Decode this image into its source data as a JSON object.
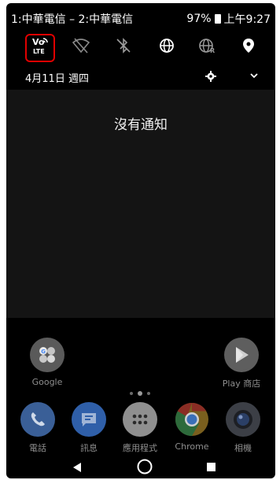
{
  "status_bar": {
    "carriers": "1:中華電信 – 2:中華電信",
    "battery": "97%",
    "time": "上午9:27"
  },
  "quick_settings": {
    "volte_label_top": "Vo",
    "volte_label_bottom": "LTE",
    "tiles": [
      {
        "name": "volte",
        "icon": "volte-icon"
      },
      {
        "name": "wifi",
        "icon": "wifi-off-icon"
      },
      {
        "name": "bluetooth",
        "icon": "bluetooth-off-icon"
      },
      {
        "name": "data",
        "icon": "globe-icon"
      },
      {
        "name": "roaming",
        "icon": "globe-roaming-icon"
      },
      {
        "name": "location",
        "icon": "location-icon"
      }
    ]
  },
  "shade": {
    "date": "4月11日 週四",
    "empty_message": "沒有通知"
  },
  "home": {
    "apps": [
      {
        "label": "Google",
        "icon": "google-folder-icon"
      },
      {
        "label": "Play 商店",
        "icon": "play-store-icon"
      }
    ],
    "dock": [
      {
        "label": "電話",
        "icon": "phone-icon",
        "color": "#4f8de0"
      },
      {
        "label": "訊息",
        "icon": "messages-icon",
        "color": "#2f6fd0"
      },
      {
        "label": "應用程式",
        "icon": "app-drawer-icon",
        "color": "#e8e8e8"
      },
      {
        "label": "Chrome",
        "icon": "chrome-icon",
        "color": "#f4b400"
      },
      {
        "label": "相機",
        "icon": "camera-icon",
        "color": "#263238"
      }
    ]
  },
  "colors": {
    "highlight": "#e00000",
    "background": "#000000"
  }
}
